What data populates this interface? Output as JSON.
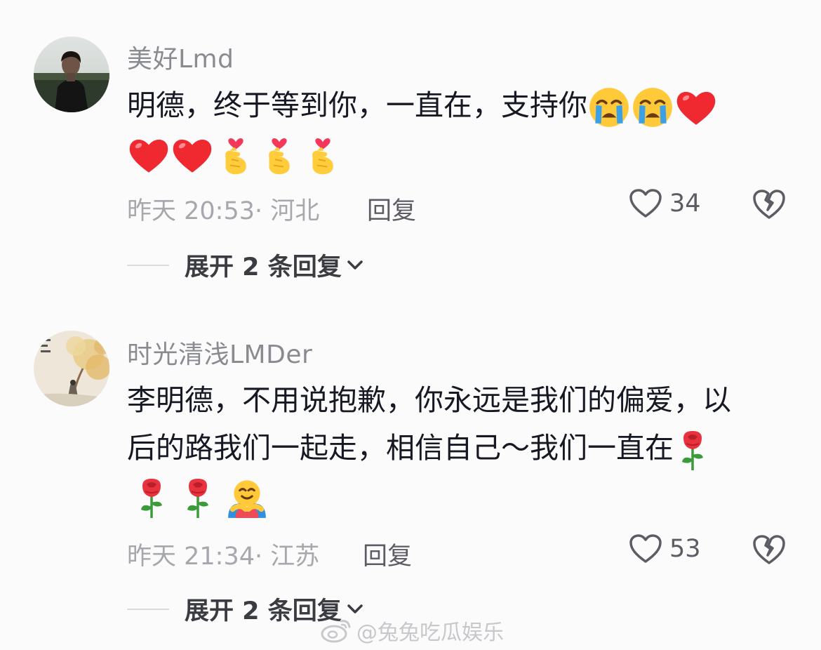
{
  "comments": [
    {
      "username": "美好Lmd",
      "text": "明德，终于等到你，一直在，支持你",
      "emojis_line1": [
        "loudly-crying-face",
        "loudly-crying-face",
        "red-heart"
      ],
      "emojis_line2": [
        "red-heart",
        "red-heart",
        "finger-heart",
        "finger-heart",
        "finger-heart"
      ],
      "time_location": "昨天 20:53· 河北",
      "reply_label": "回复",
      "likes": "34",
      "expand_label": "展开 2 条回复"
    },
    {
      "username": "时光清浅LMDer",
      "text_line1": "李明德，不用说抱歉，你永远是我们的偏爱，以",
      "text_line2": "后的路我们一起走，相信自己～我们一直在",
      "emojis_line3": [
        "rose",
        "rose",
        "people-hugging"
      ],
      "time_location": "昨天 21:34· 江苏",
      "reply_label": "回复",
      "likes": "53",
      "expand_label": "展开 2 条回复"
    }
  ],
  "watermark": "@兔兔吃瓜娱乐",
  "colors": {
    "background": "#fbfbfb",
    "username": "#8a8b91",
    "meta": "#a7a8ad",
    "text": "#161823"
  }
}
